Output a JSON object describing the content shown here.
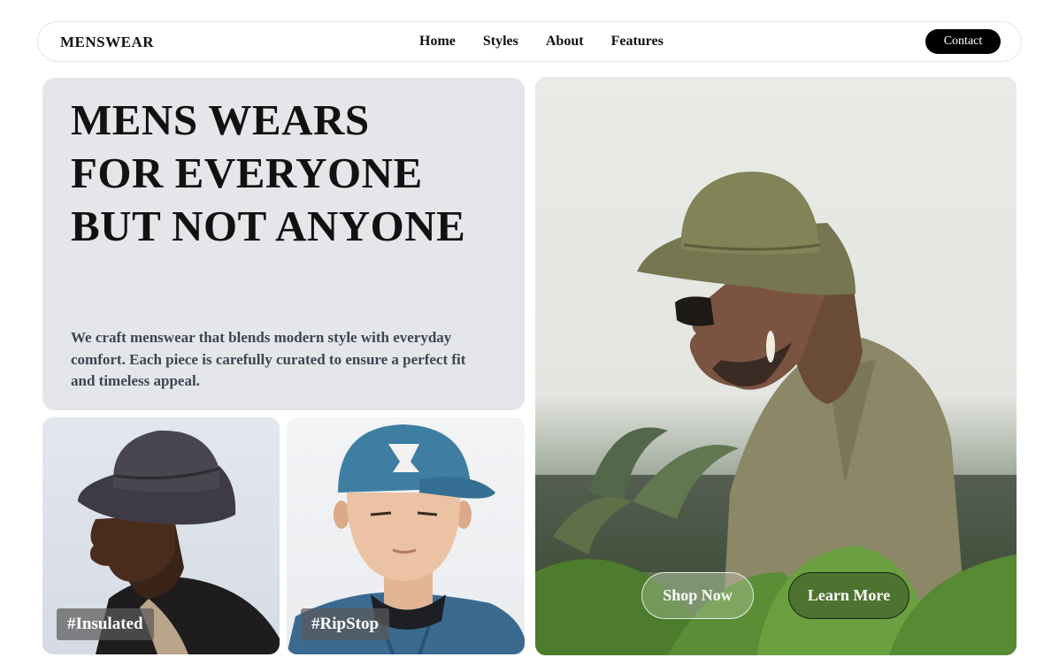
{
  "nav": {
    "brand": "MENSWEAR",
    "links": [
      "Home",
      "Styles",
      "About",
      "Features"
    ],
    "contact_label": "Contact"
  },
  "hero": {
    "title_lines": [
      "MENS WEARS",
      "FOR EVERYONE",
      "BUT NOT ANYONE"
    ],
    "description": "We craft menswear that blends modern style with everyday comfort. Each piece is carefully curated to ensure a perfect fit and timeless appeal."
  },
  "cards": [
    {
      "tag": "#Insulated",
      "image": "man-black-bucket-hat"
    },
    {
      "tag": "#RipStop",
      "image": "man-blue-cap-denim"
    }
  ],
  "feature_image": {
    "image": "man-olive-bucket-hat-garden",
    "shop_label": "Shop Now",
    "learn_label": "Learn More"
  },
  "colors": {
    "hero_bg": "#e4e6e9",
    "accent": "#000000",
    "description_text": "#3d4654"
  }
}
